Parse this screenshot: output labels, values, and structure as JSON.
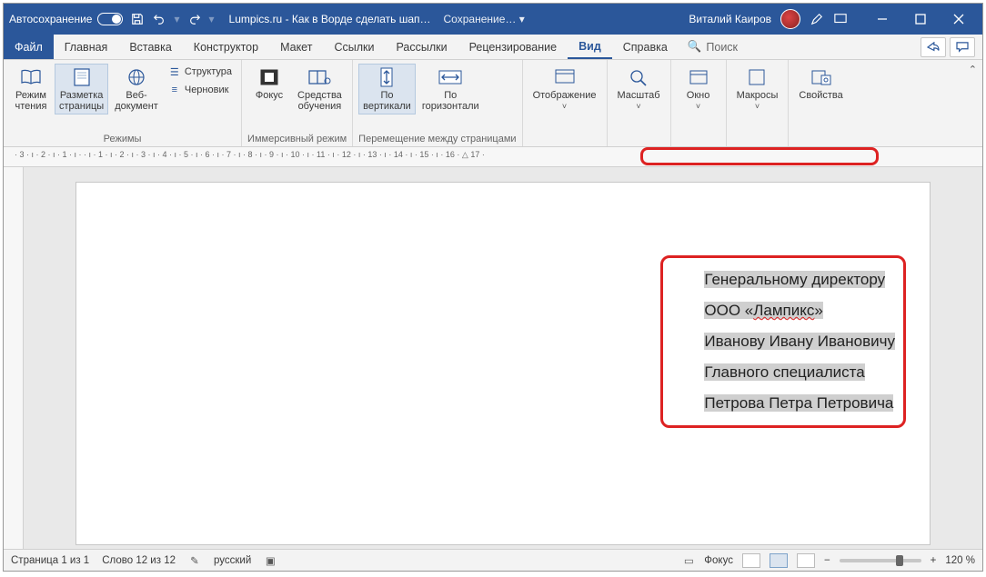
{
  "titlebar": {
    "autosave_label": "Автосохранение",
    "doc_title": "Lumpics.ru - Как в Ворде сделать шап…",
    "saving_label": "Сохранение…",
    "username": "Виталий Каиров"
  },
  "tabs": {
    "file": "Файл",
    "home": "Главная",
    "insert": "Вставка",
    "design": "Конструктор",
    "layout": "Макет",
    "references": "Ссылки",
    "mailings": "Рассылки",
    "review": "Рецензирование",
    "view": "Вид",
    "help": "Справка",
    "search": "Поиск"
  },
  "ribbon": {
    "views": {
      "read_mode": "Режим\nчтения",
      "print_layout": "Разметка\nстраницы",
      "web_layout": "Веб-\nдокумент",
      "outline": "Структура",
      "draft": "Черновик",
      "group": "Режимы"
    },
    "immersive": {
      "focus": "Фокус",
      "learning": "Средства\nобучения",
      "group": "Иммерсивный режим"
    },
    "page_move": {
      "vertical": "По\nвертикали",
      "horizontal": "По\nгоризонтали",
      "group": "Перемещение между страницами"
    },
    "show": {
      "label": "Отображение",
      "group": ""
    },
    "zoom": {
      "label": "Масштаб",
      "group": ""
    },
    "window": {
      "label": "Окно",
      "group": ""
    },
    "macros": {
      "label": "Макросы",
      "group": ""
    },
    "properties": {
      "label": "Свойства",
      "group": ""
    }
  },
  "document": {
    "lines": [
      "Генеральному директору",
      "ООО «Лампикс»",
      "Иванову Ивану Ивановичу",
      "Главного специалиста",
      "Петрова Петра Петровича"
    ]
  },
  "statusbar": {
    "page": "Страница 1 из 1",
    "words": "Слово 12 из 12",
    "lang": "русский",
    "focus": "Фокус",
    "zoom": "120 %"
  },
  "ruler_text": "· 3 · ı · 2 · ı · 1 · ı ·    · ı · 1 · ı · 2 · ı · 3 · ı · 4 · ı · 5 · ı · 6 · ı · 7 · ı · 8 · ı · 9 · ı · 10 · ı · 11 · ı · 12 · ı · 13 · ı · 14 · ı · 15 · ı · 16 · △ 17 ·"
}
